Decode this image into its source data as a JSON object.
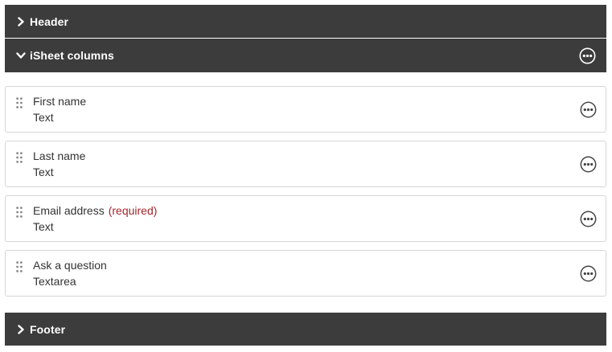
{
  "sections": {
    "header": {
      "label": "Header",
      "expanded": false
    },
    "columns": {
      "label": "iSheet columns",
      "expanded": true
    },
    "footer": {
      "label": "Footer",
      "expanded": false
    }
  },
  "columns": [
    {
      "name": "First name",
      "required_label": "",
      "type": "Text"
    },
    {
      "name": "Last name",
      "required_label": "",
      "type": "Text"
    },
    {
      "name": "Email address",
      "required_label": "(required)",
      "type": "Text"
    },
    {
      "name": "Ask a question",
      "required_label": "",
      "type": "Textarea"
    }
  ],
  "colors": {
    "bar_background": "#3c3c3c",
    "required_text": "#a3262b",
    "row_border": "#d6d6d6"
  },
  "icons": {
    "collapsed": "chevron-right-icon",
    "expanded": "chevron-down-icon",
    "menu": "more-options-icon",
    "drag": "drag-handle-icon"
  }
}
